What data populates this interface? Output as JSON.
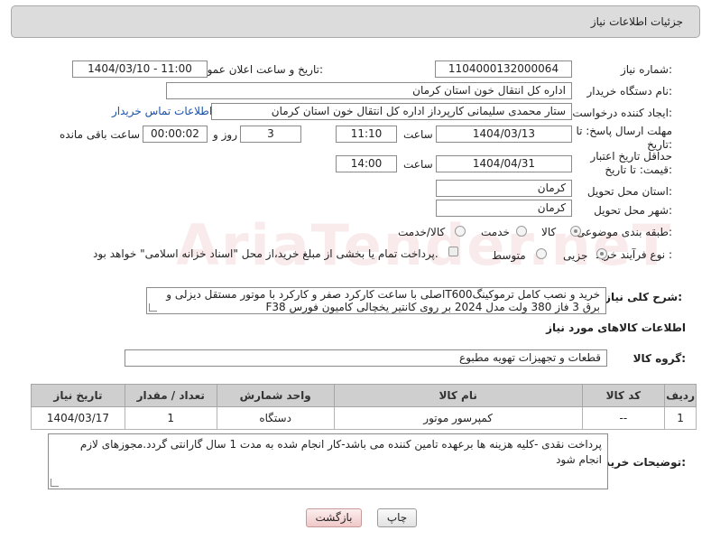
{
  "header": {
    "title": "جزئیات اطلاعات نیاز"
  },
  "watermark": "AriaTender.neT",
  "form": {
    "need_number": {
      "label": "شماره نیاز:",
      "value": "1104000132000064"
    },
    "announce": {
      "label": "تاریخ و ساعت اعلان عمومی:",
      "value": "1404/03/10 - 11:00"
    },
    "buyer_org": {
      "label": "نام دستگاه خریدار:",
      "value": "اداره کل انتقال خون استان کرمان"
    },
    "requester": {
      "label": "ایجاد کننده درخواست:",
      "value": "ستار محمدی سلیمانی کارپرداز اداره کل انتقال خون استان کرمان",
      "contact_link": "اطلاعات تماس خریدار"
    },
    "deadline": {
      "label": "مهلت ارسال پاسخ: تا تاریخ:",
      "date": "1404/03/13",
      "time_label": "ساعت",
      "time": "11:10",
      "days": "3",
      "days_label": "روز و",
      "remaining": "00:00:02",
      "remaining_label": "ساعت باقی مانده"
    },
    "price_validity": {
      "label": "حداقل تاریخ اعتبار قیمت: تا تاریخ:",
      "date": "1404/04/31",
      "time_label": "ساعت",
      "time": "14:00"
    },
    "province": {
      "label": "استان محل تحویل:",
      "value": "کرمان"
    },
    "city": {
      "label": "شهر محل تحویل:",
      "value": "کرمان"
    },
    "category": {
      "label": "طبقه بندی موضوعی:",
      "options": [
        "کالا",
        "خدمت",
        "کالا/خدمت"
      ],
      "selected": "کالا"
    },
    "process": {
      "label": "نوع فرآیند خرید :",
      "options": [
        "جزیی",
        "متوسط"
      ],
      "selected": "جزیی",
      "payment_note": "پرداخت تمام یا بخشی از مبلغ خرید،از محل \"اسناد خزانه اسلامی\" خواهد بود."
    },
    "description": {
      "label": "شرح کلی نیاز:",
      "value": "خرید و نصب کامل ترموکینگT600اصلی با ساعت کارکرد صفر و کارکرد با موتور مستقل دیزلی و برق 3 فاز 380 ولت مدل 2024 بر روی کانتیر یخچالی کامیون فورس F38"
    }
  },
  "goods": {
    "section_title": "اطلاعات کالاهای مورد نیاز",
    "group_label": "گروه کالا:",
    "group_value": "قطعات و تجهیزات تهویه مطبوع",
    "columns": [
      "ردیف",
      "کد کالا",
      "نام کالا",
      "واحد شمارش",
      "تعداد / مقدار",
      "تاریخ نیاز"
    ],
    "rows": [
      [
        "1",
        "--",
        "کمپرسور موتور",
        "دستگاه",
        "1",
        "1404/03/17"
      ]
    ]
  },
  "buyer_notes": {
    "label": "توضیحات خریدار:",
    "value": "پرداخت نقدی -کلیه هزینه ها برعهده تامین کننده می باشد-کار انجام شده به مدت 1 سال گارانتی گردد.مجوزهای لازم  انجام شود"
  },
  "buttons": {
    "print": "چاپ",
    "back": "بازگشت"
  }
}
